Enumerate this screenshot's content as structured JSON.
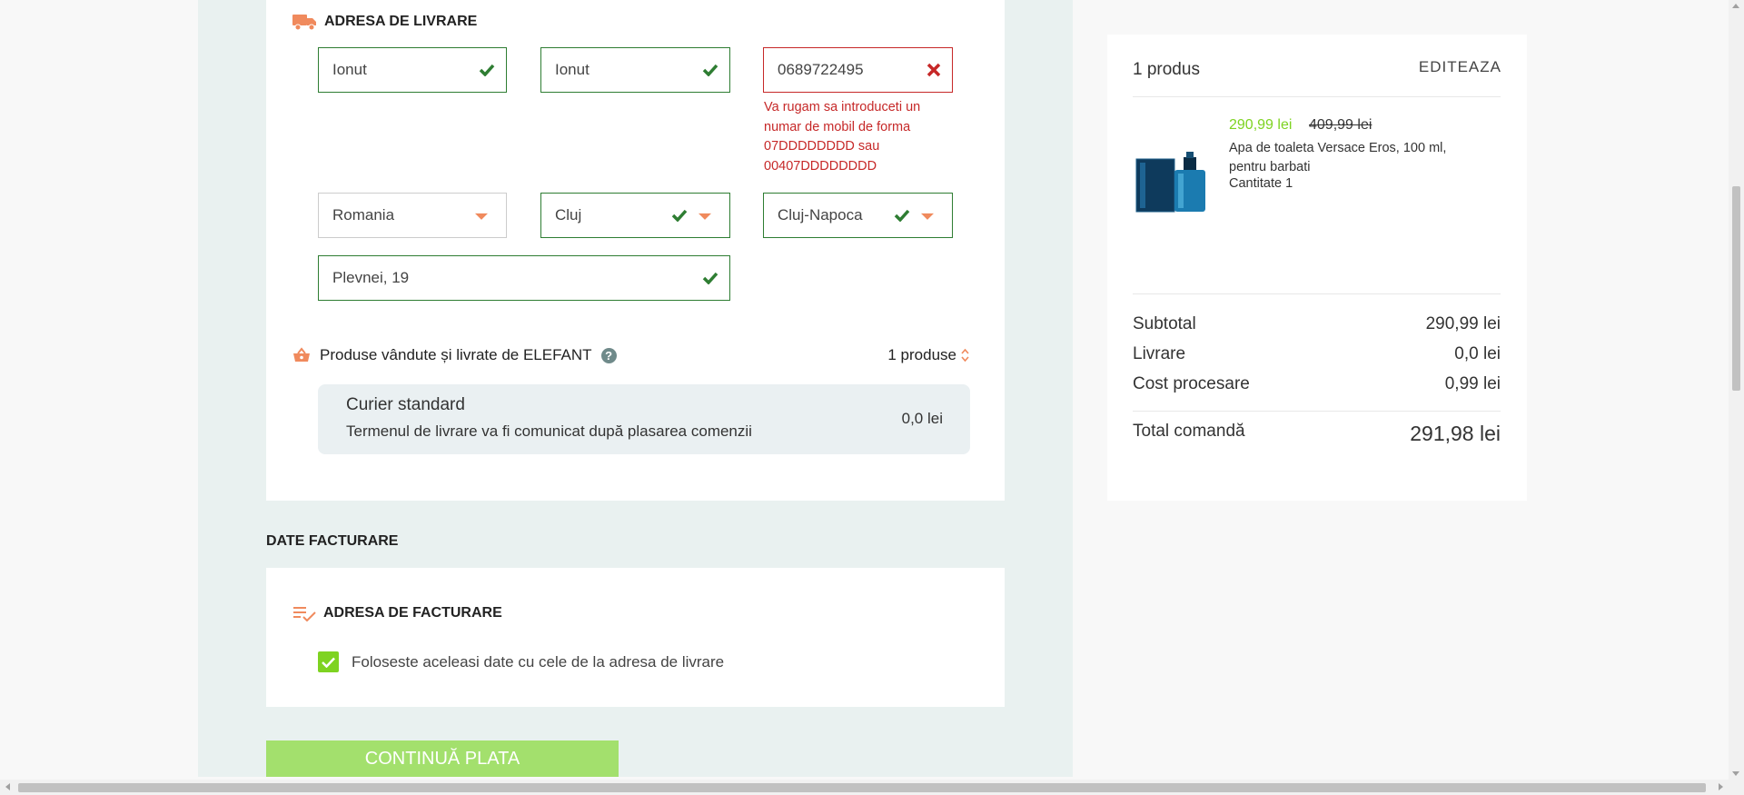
{
  "delivery": {
    "title": "ADRESA DE LIVRARE",
    "fields": {
      "first_name": "Ionut",
      "last_name": "Ionut",
      "phone": "0689722495",
      "country": "Romania",
      "county": "Cluj",
      "city": "Cluj-Napoca",
      "street": "Plevnei, 19"
    },
    "phone_error": "Va rugam sa introduceti un numar de mobil de forma 07DDDDDDDD sau 00407DDDDDDDD",
    "seller_label": "Produse vândute și livrate de ELEFANT",
    "help_icon": "?",
    "products_count": "1 produse",
    "courier": {
      "name": "Curier standard",
      "description": "Termenul de livrare va fi comunicat după plasarea comenzii",
      "price": "0,0 lei"
    }
  },
  "billing": {
    "heading": "DATE FACTURARE",
    "title": "ADRESA DE FACTURARE",
    "same_as_delivery_label": "Foloseste aceleasi date cu cele de la adresa de livrare",
    "same_as_delivery_checked": true
  },
  "continue_button": "CONTINUĂ PLATA",
  "summary": {
    "count": "1 produs",
    "edit_label": "EDITEAZA",
    "product": {
      "price": "290,99 lei",
      "old_price": "409,99 lei",
      "name": "Apa de toaleta Versace Eros, 100 ml, pentru barbati",
      "quantity": "Cantitate 1"
    },
    "rows": [
      {
        "label": "Subtotal",
        "value": "290,99 lei"
      },
      {
        "label": "Livrare",
        "value": "0,0 lei"
      },
      {
        "label": "Cost procesare",
        "value": "0,99 lei"
      }
    ],
    "total": {
      "label": "Total comandă",
      "value": "291,98 lei"
    }
  },
  "colors": {
    "valid": "#2e7d32",
    "error": "#c62828",
    "accent_orange": "#f08a5d",
    "price_green": "#7ed321",
    "button_green": "#a3e06d"
  },
  "icons": {
    "delivery": "truck-icon",
    "billing": "list-check-icon",
    "seller": "basket-icon",
    "valid": "check-icon",
    "invalid": "x-icon",
    "dropdown": "caret-down-icon",
    "sort": "sort-icon"
  }
}
